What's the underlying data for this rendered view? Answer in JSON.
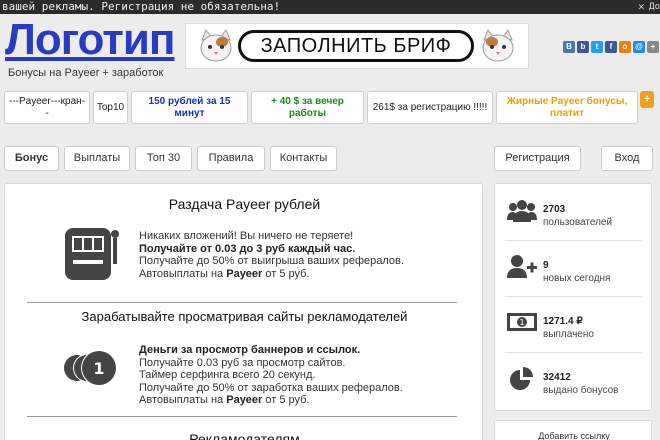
{
  "ticker": {
    "text": "вашей рекламы. Регистрация не обязательна!",
    "right_hint": "До"
  },
  "header": {
    "logo": "Логотип",
    "tagline": "Бонусы на Payeer + заработок",
    "banner_text": "ЗАПОЛНИТЬ БРИФ",
    "social_icons": [
      "vk-icon",
      "blogger-icon",
      "twitter-icon",
      "facebook-icon",
      "odnoklassniki-icon",
      "mailru-icon",
      "plus-icon"
    ]
  },
  "ad_links": [
    {
      "label": "---Payeer---кран--",
      "color": "#222222"
    },
    {
      "label": "Top10",
      "color": "#222222"
    },
    {
      "label": "150 рублей за 15 минут",
      "color": "#1a2fb0"
    },
    {
      "label": "+ 40 $ за вечер работы",
      "color": "#1a8a1a"
    },
    {
      "label": "261$ за регистрацию !!!!!",
      "color": "#222222"
    },
    {
      "label": "Жирные Payeer бонусы, платит",
      "color": "#e6a000"
    }
  ],
  "ad_plus": "+",
  "nav": {
    "left": [
      "Бонус",
      "Выплаты",
      "Топ 30",
      "Правила",
      "Контакты"
    ],
    "register": "Регистрация",
    "login": "Вход"
  },
  "main": {
    "section1": {
      "title": "Раздача Payeer рублей",
      "line1": "Никаких вложений! Вы ничего не теряете!",
      "line2": "Получайте от 0.03 до 3 руб каждый час.",
      "line3": "Получайте до 50% от выигрыша ваших рефералов.",
      "line4_prefix": "Автовыплаты на ",
      "line4_bold": "Payeer",
      "line4_suffix": " от 5 руб."
    },
    "section2": {
      "title": "Зарабатывайте просматривая сайты рекламодателей",
      "line1": "Деньги за просмотр баннеров и ссылок.",
      "line2": "Получайте 0.03 руб за просмотр сайтов.",
      "line3": "Таймер серфинга всего 20 секунд.",
      "line4": "Получайте до 50% от заработка ваших рефералов.",
      "line5_prefix": "Автовыплаты на ",
      "line5_bold": "Payeer",
      "line5_suffix": " от 5 руб."
    },
    "section3": {
      "title": "Рекламодателям"
    }
  },
  "stats": [
    {
      "icon": "users-icon",
      "value": "2703",
      "label": "пользователей"
    },
    {
      "icon": "add-user-icon",
      "value": "9",
      "label": "новых сегодня"
    },
    {
      "icon": "money-icon",
      "value": "1271.4 ₽",
      "label": "выплачено"
    },
    {
      "icon": "pie-chart-icon",
      "value": "32412",
      "label": "выдано бонусов"
    }
  ],
  "add_link": "Добавить ссылку",
  "colors": {
    "logo": "#2a3bbf",
    "background": "#ececec"
  }
}
